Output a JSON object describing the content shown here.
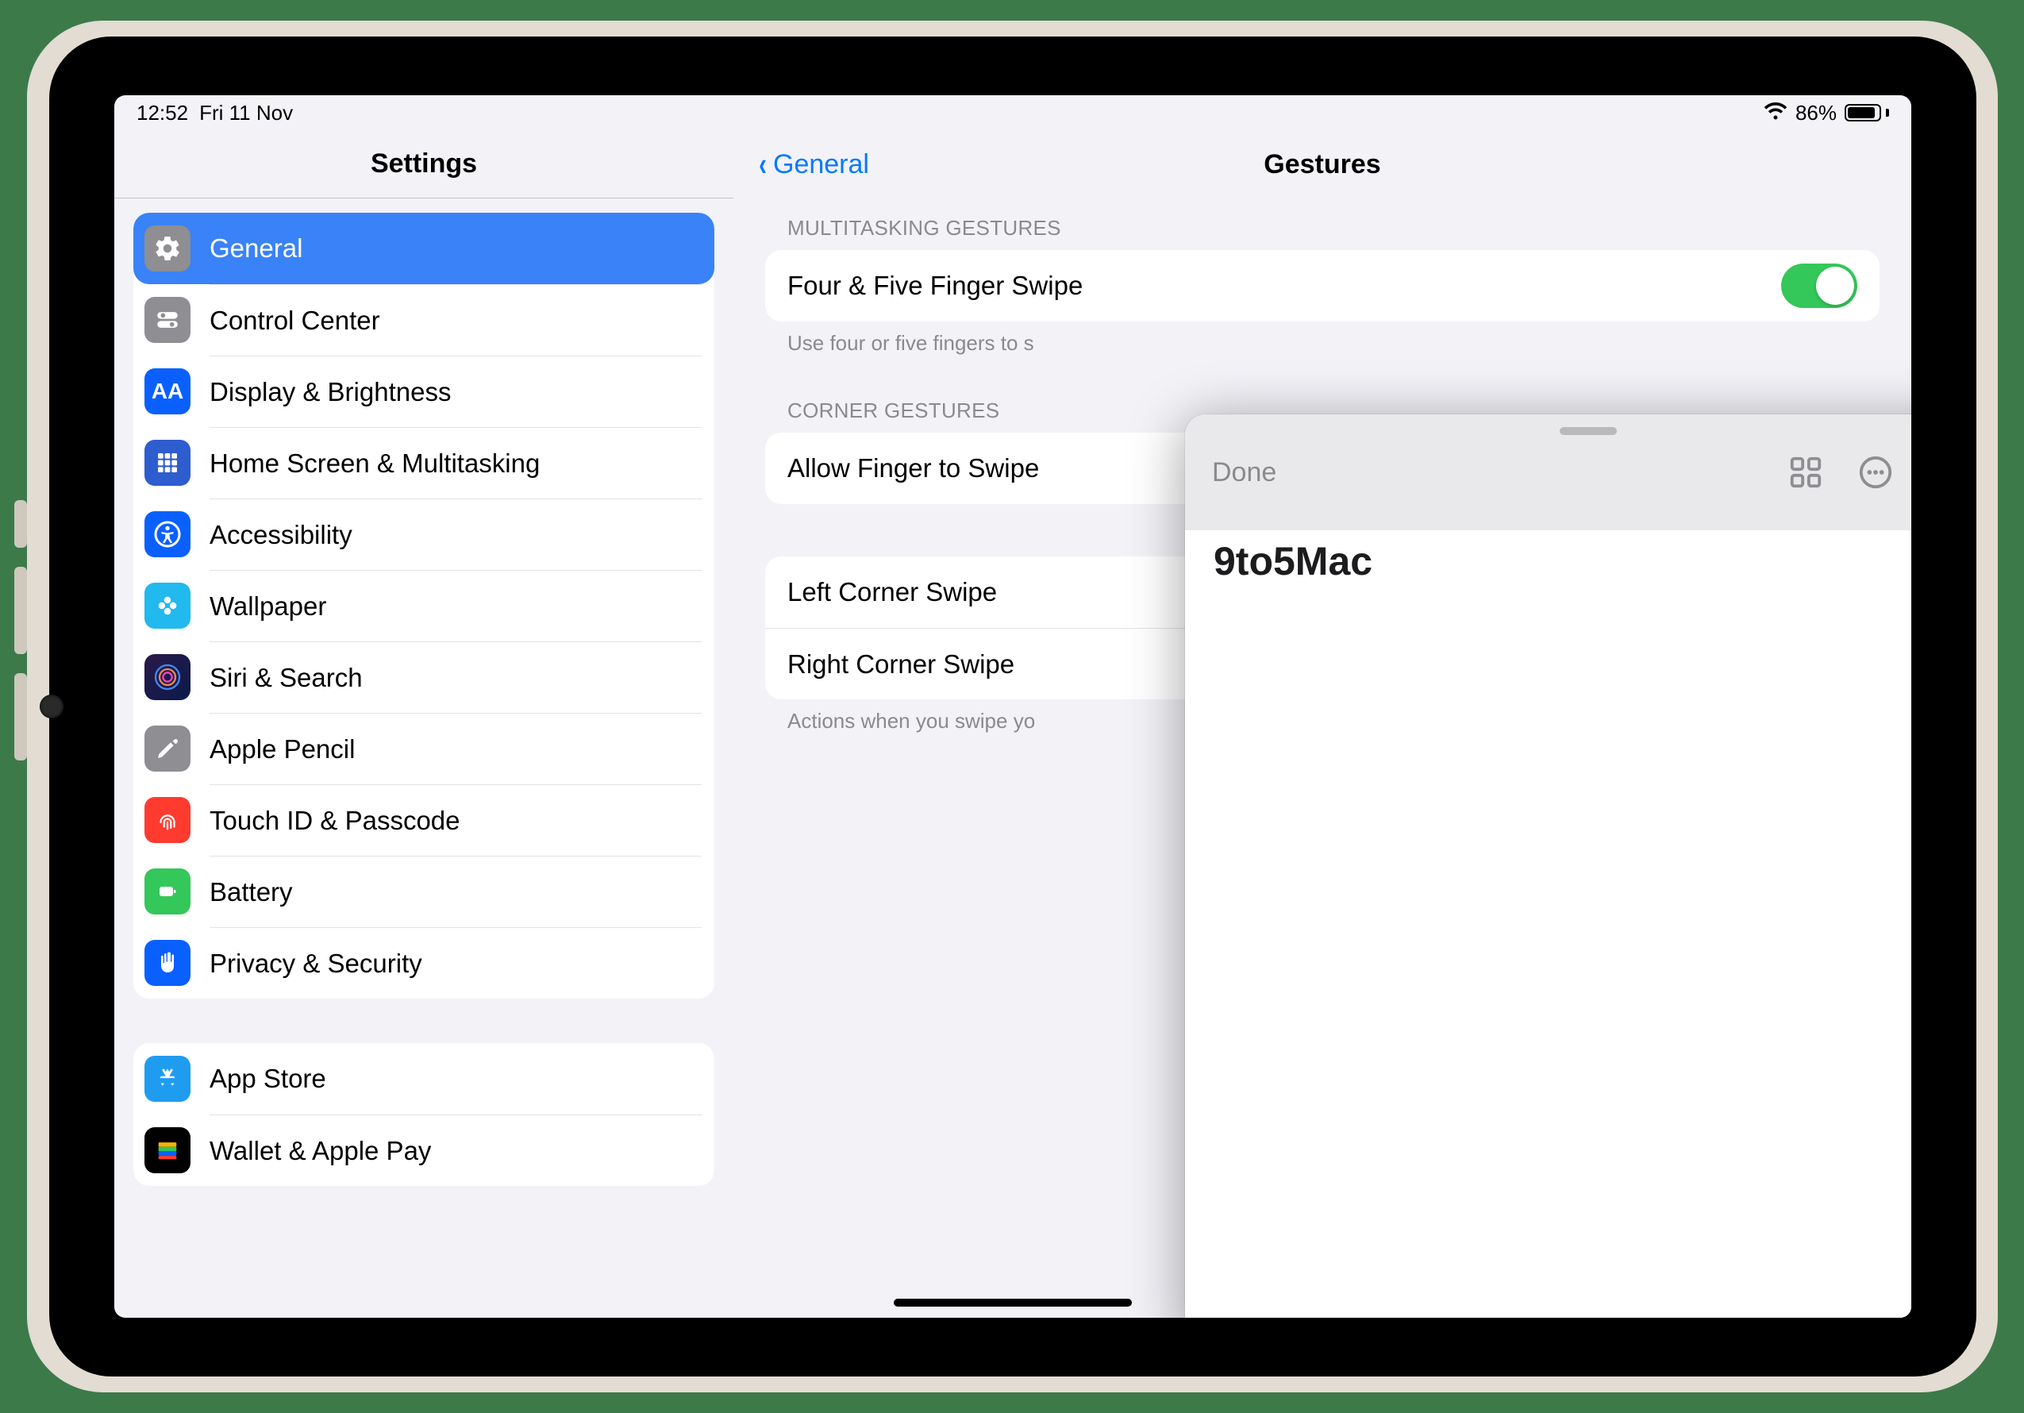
{
  "status": {
    "time": "12:52",
    "date": "Fri 11 Nov",
    "battery_pct": "86%"
  },
  "nav": {
    "sidebar_title": "Settings",
    "back_label": "General",
    "detail_title": "Gestures"
  },
  "sidebar": {
    "group1": [
      {
        "label": "General"
      },
      {
        "label": "Control Center"
      },
      {
        "label": "Display & Brightness"
      },
      {
        "label": "Home Screen & Multitasking"
      },
      {
        "label": "Accessibility"
      },
      {
        "label": "Wallpaper"
      },
      {
        "label": "Siri & Search"
      },
      {
        "label": "Apple Pencil"
      },
      {
        "label": "Touch ID & Passcode"
      },
      {
        "label": "Battery"
      },
      {
        "label": "Privacy & Security"
      }
    ],
    "group2": [
      {
        "label": "App Store"
      },
      {
        "label": "Wallet & Apple Pay"
      }
    ]
  },
  "detail": {
    "section1_header": "MULTITASKING GESTURES",
    "row1": "Four & Five Finger Swipe",
    "footnote1": "Use four or five fingers to s",
    "section2_header": "CORNER GESTURES",
    "row2": "Allow Finger to Swipe",
    "row3": "Left Corner Swipe",
    "row4": "Right Corner Swipe",
    "footnote2": "Actions when you swipe yo"
  },
  "quicknote": {
    "done": "Done",
    "title": "9to5Mac"
  }
}
